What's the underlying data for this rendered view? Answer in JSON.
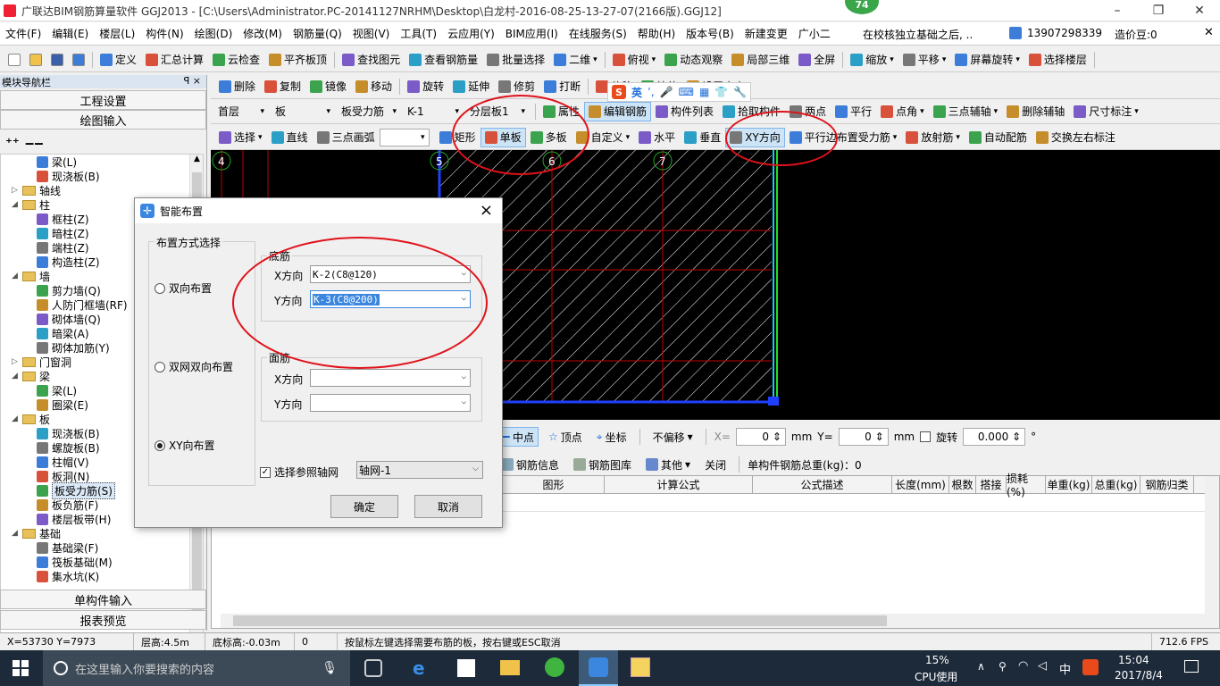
{
  "window": {
    "title": "广联达BIM钢筋算量软件 GGJ2013 - [C:\\Users\\Administrator.PC-20141127NRHM\\Desktop\\白龙村-2016-08-25-13-27-07(2166版).GGJ12]"
  },
  "badge": "74",
  "menu": [
    "文件(F)",
    "编辑(E)",
    "楼层(L)",
    "构件(N)",
    "绘图(D)",
    "修改(M)",
    "钢筋量(Q)",
    "视图(V)",
    "工具(T)",
    "云应用(Y)",
    "BIM应用(I)",
    "在线服务(S)",
    "帮助(H)",
    "版本号(B)",
    "新建变更",
    "广小二"
  ],
  "menu_notice": "在校核独立基础之后, ..",
  "menu_user": "13907298339",
  "menu_price": "造价豆:0",
  "toolbar1": [
    "定义",
    "汇总计算",
    "云检查",
    "平齐板顶",
    "查找图元",
    "查看钢筋量",
    "批量选择",
    "二维",
    "俯视",
    "动态观察",
    "局部三维",
    "全屏",
    "缩放",
    "平移",
    "屏幕旋转",
    "选择楼层"
  ],
  "toolbar2": [
    "删除",
    "复制",
    "镜像",
    "移动",
    "旋转",
    "延伸",
    "修剪",
    "打断",
    "偏移",
    "拉伸",
    "设置夹点"
  ],
  "ime_label": "英",
  "toolbar3": {
    "combos": [
      "首层",
      "板",
      "板受力筋",
      "K-1",
      "分层板1"
    ],
    "items": [
      "属性",
      "编辑钢筋",
      "构件列表",
      "拾取构件",
      "两点",
      "平行",
      "点角",
      "三点辅轴",
      "删除辅轴",
      "尺寸标注"
    ]
  },
  "toolbar4": [
    "选择",
    "直线",
    "三点画弧",
    "矩形",
    "单板",
    "多板",
    "自定义",
    "水平",
    "垂直",
    "XY方向",
    "平行边布置受力筋",
    "放射筋",
    "自动配筋",
    "交换左右标注"
  ],
  "left_panel": {
    "header": "模块导航栏",
    "pin": "ꟼ ×",
    "btn1": "工程设置",
    "btn2": "绘图输入",
    "btn3": "单构件输入",
    "btn4": "报表预览",
    "tree": [
      {
        "label": "梁(L)",
        "level": 2,
        "type": "item"
      },
      {
        "label": "现浇板(B)",
        "level": 2,
        "type": "item"
      },
      {
        "label": "轴线",
        "level": 0,
        "type": "folder",
        "exp": "▷"
      },
      {
        "label": "柱",
        "level": 0,
        "type": "folder",
        "exp": "◢"
      },
      {
        "label": "框柱(Z)",
        "level": 2,
        "type": "item"
      },
      {
        "label": "暗柱(Z)",
        "level": 2,
        "type": "item"
      },
      {
        "label": "端柱(Z)",
        "level": 2,
        "type": "item"
      },
      {
        "label": "构造柱(Z)",
        "level": 2,
        "type": "item"
      },
      {
        "label": "墙",
        "level": 0,
        "type": "folder",
        "exp": "◢"
      },
      {
        "label": "剪力墙(Q)",
        "level": 2,
        "type": "item"
      },
      {
        "label": "人防门框墙(RF)",
        "level": 2,
        "type": "item"
      },
      {
        "label": "砌体墙(Q)",
        "level": 2,
        "type": "item"
      },
      {
        "label": "暗梁(A)",
        "level": 2,
        "type": "item"
      },
      {
        "label": "砌体加筋(Y)",
        "level": 2,
        "type": "item"
      },
      {
        "label": "门窗洞",
        "level": 0,
        "type": "folder",
        "exp": "▷"
      },
      {
        "label": "梁",
        "level": 0,
        "type": "folder",
        "exp": "◢"
      },
      {
        "label": "梁(L)",
        "level": 2,
        "type": "item"
      },
      {
        "label": "圈梁(E)",
        "level": 2,
        "type": "item"
      },
      {
        "label": "板",
        "level": 0,
        "type": "folder",
        "exp": "◢"
      },
      {
        "label": "现浇板(B)",
        "level": 2,
        "type": "item"
      },
      {
        "label": "螺旋板(B)",
        "level": 2,
        "type": "item"
      },
      {
        "label": "柱帽(V)",
        "level": 2,
        "type": "item"
      },
      {
        "label": "板洞(N)",
        "level": 2,
        "type": "item"
      },
      {
        "label": "板受力筋(S)",
        "level": 2,
        "type": "item",
        "selected": true
      },
      {
        "label": "板负筋(F)",
        "level": 2,
        "type": "item"
      },
      {
        "label": "楼层板带(H)",
        "level": 2,
        "type": "item"
      },
      {
        "label": "基础",
        "level": 0,
        "type": "folder",
        "exp": "◢"
      },
      {
        "label": "基础梁(F)",
        "level": 2,
        "type": "item"
      },
      {
        "label": "筏板基础(M)",
        "level": 2,
        "type": "item"
      },
      {
        "label": "集水坑(K)",
        "level": 2,
        "type": "item"
      }
    ]
  },
  "canvas": {
    "axis_labels": [
      "4",
      "5",
      "6",
      "7"
    ]
  },
  "coord_bar": {
    "items": [
      "中点",
      "顶点",
      "坐标"
    ],
    "offset": "不偏移",
    "x_label": "X=",
    "x_value": "0",
    "unit": "mm",
    "y_label": "Y=",
    "y_value": "0",
    "rotate_label": "旋转",
    "rotate_value": "0.000",
    "deg": "°"
  },
  "rebar_bar": {
    "items": [
      "钢筋信息",
      "钢筋图库",
      "其他",
      "关闭"
    ],
    "total": "单构件钢筋总重(kg)：0"
  },
  "grid_columns": [
    "图形",
    "计算公式",
    "公式描述",
    "长度(mm)",
    "根数",
    "搭接",
    "损耗(%)",
    "单重(kg)",
    "总重(kg)",
    "钢筋归类"
  ],
  "dialog": {
    "title": "智能布置",
    "close": "×",
    "group_label": "布置方式选择",
    "options": [
      "双向布置",
      "双网双向布置",
      "XY向布置"
    ],
    "bottom_label": "底筋",
    "top_label": "面筋",
    "x_label": "X方向",
    "y_label": "Y方向",
    "bottom_x": "K-2(C8@120)",
    "bottom_y": "K-3(C8@200)",
    "top_x": "",
    "top_y": "",
    "axis_check_label": "选择参照轴网",
    "axis_value": "轴网-1",
    "ok": "确定",
    "cancel": "取消"
  },
  "status": {
    "coord": "X=53730 Y=7973",
    "floor_height": "层高:4.5m",
    "base_height": "底标高:-0.03m",
    "zero": "0",
    "hint": "按鼠标左键选择需要布筋的板，按右键或ESC取消",
    "fps": "712.6 FPS"
  },
  "taskbar": {
    "search_placeholder": "在这里输入你要搜索的内容",
    "cpu": "15%",
    "cpu_label": "CPU使用",
    "ime": "中",
    "time": "15:04",
    "date": "2017/8/4"
  },
  "colors": {
    "accent_blue": "#1e6fd9",
    "annotation_red": "#e0121a",
    "grid_red": "#c00000",
    "canvas_bg": "#000000"
  }
}
